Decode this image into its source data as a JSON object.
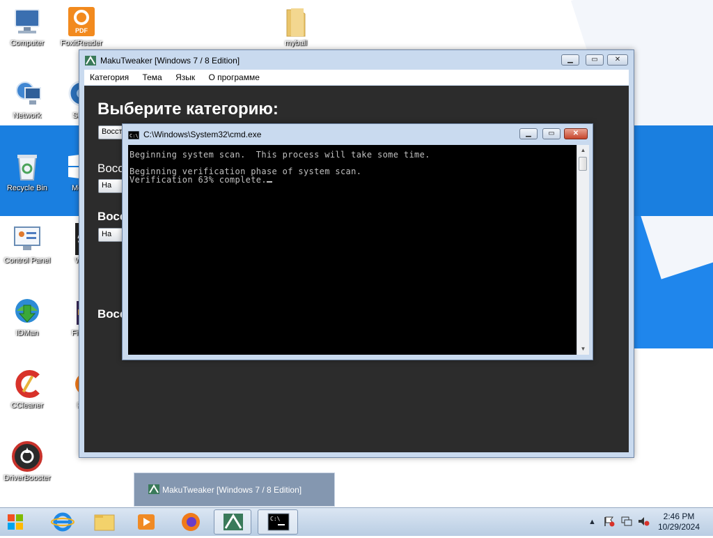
{
  "desktop": {
    "icons": [
      {
        "label": "Computer"
      },
      {
        "label": "FoxitReader"
      },
      {
        "label": "myball"
      },
      {
        "label": "Network"
      },
      {
        "label": "Supe"
      },
      {
        "label": "Recycle Bin"
      },
      {
        "label": "Metro"
      },
      {
        "label": "Control Panel"
      },
      {
        "label": "Win"
      },
      {
        "label": "IDMan"
      },
      {
        "label": "Firefo"
      },
      {
        "label": "CCleaner"
      },
      {
        "label": "Fir"
      },
      {
        "label": "DriverBooster"
      }
    ]
  },
  "maku": {
    "title": "MakuTweaker [Windows 7 / 8 Edition]",
    "menu": [
      "Категория",
      "Тема",
      "Язык",
      "О программе"
    ],
    "heading": "Выберите категорию:",
    "dropdown_partial": "Восст",
    "sections": [
      "Восс",
      "Восс",
      "Восс"
    ],
    "buttons": [
      "На",
      "На"
    ]
  },
  "cmd": {
    "title": "C:\\Windows\\System32\\cmd.exe",
    "lines": [
      "Beginning system scan.  This process will take some time.",
      "",
      "Beginning verification phase of system scan.",
      "Verification 63% complete."
    ],
    "progress_percent": 63
  },
  "taskbar": {
    "preview_title": "MakuTweaker [Windows 7 / 8 Edition]",
    "time": "2:46 PM",
    "date": "10/29/2024",
    "tray_icons": [
      "show-hidden-icons",
      "action-center-flag",
      "network",
      "volume-muted"
    ],
    "pinned": [
      "start",
      "internet-explorer",
      "file-explorer",
      "media-player",
      "firefox",
      "makutweaker",
      "cmd"
    ]
  },
  "colors": {
    "console_bg": "#000000",
    "console_text": "#c0c0c0",
    "maku_bg": "#2c2c2c",
    "wallpaper_accent": "#1a7fe0"
  }
}
